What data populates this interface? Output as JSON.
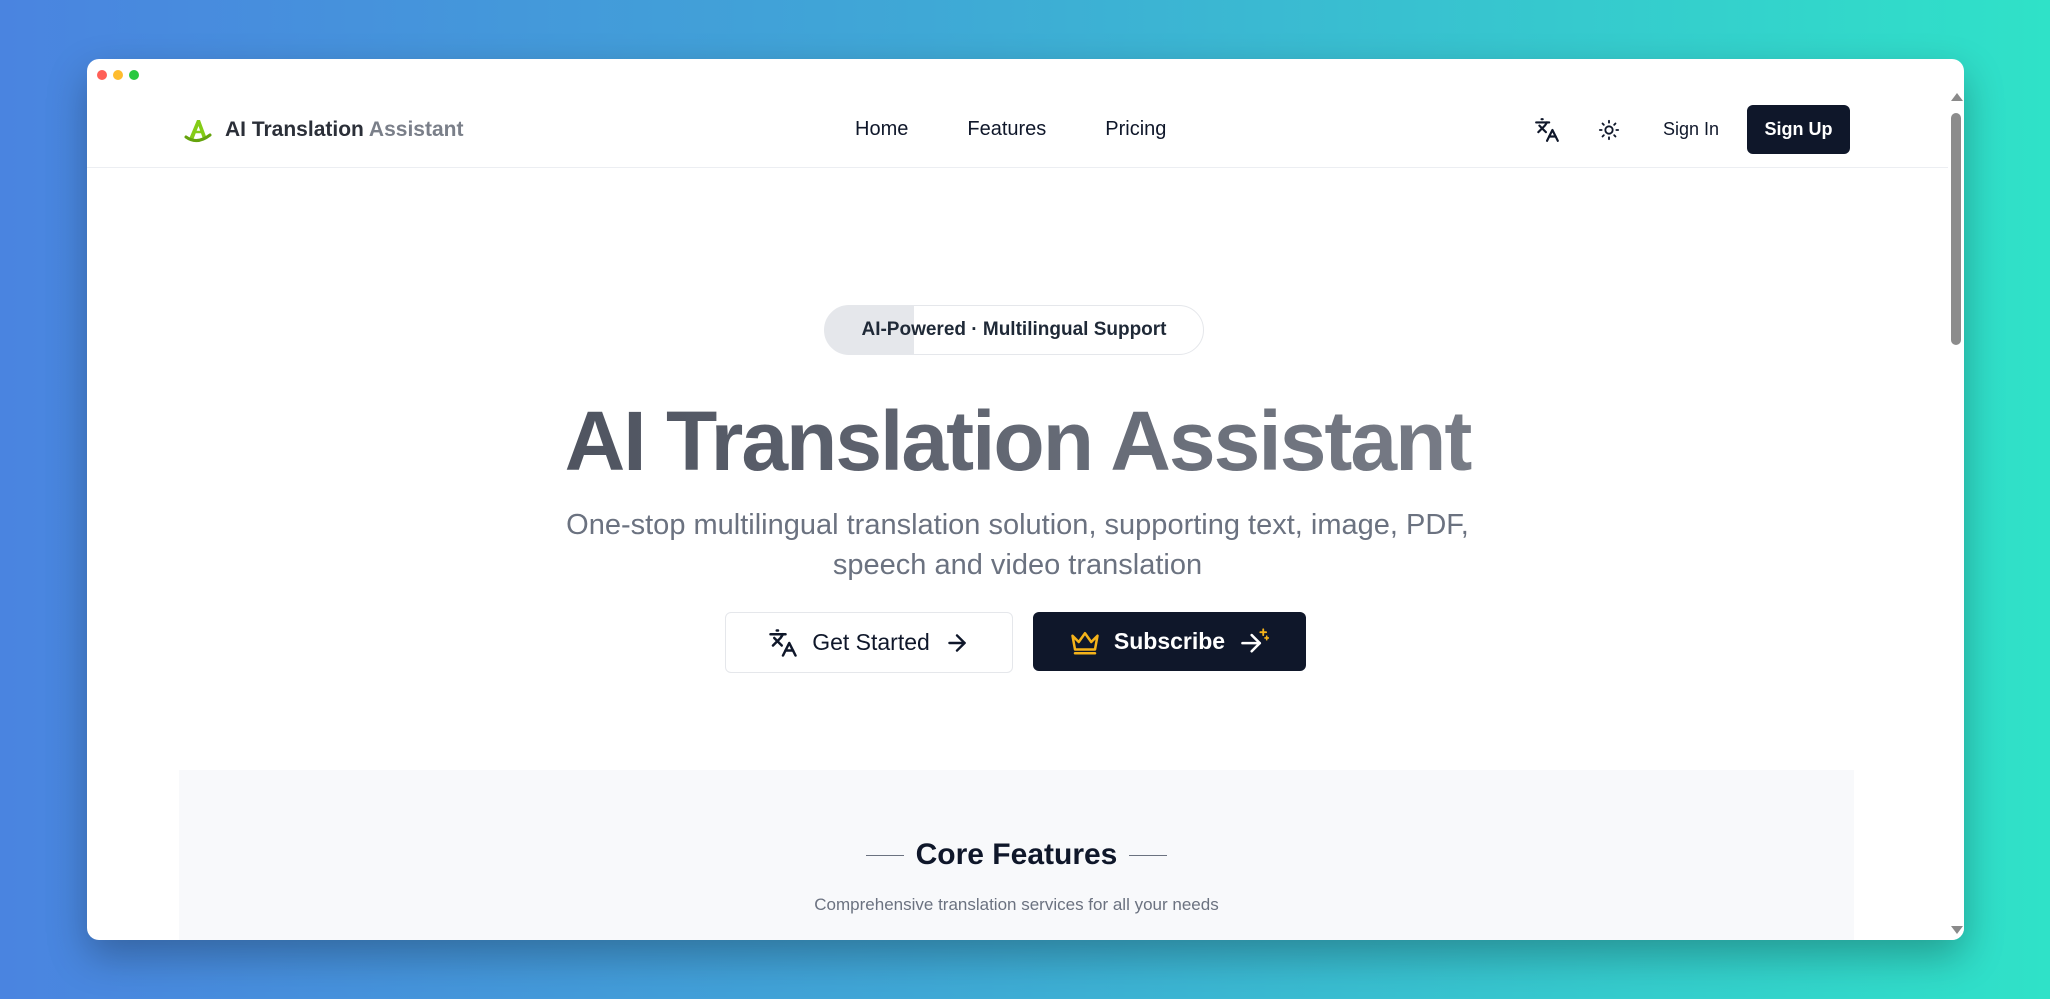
{
  "nav": {
    "brand_part1": "AI Translation",
    "brand_part2": "Assistant",
    "links": [
      "Home",
      "Features",
      "Pricing"
    ],
    "sign_in": "Sign In",
    "sign_up": "Sign Up",
    "icons": [
      "translate-icon",
      "sun-icon"
    ]
  },
  "hero": {
    "badge": "AI-Powered · Multilingual Support",
    "title": "AI Translation Assistant",
    "subtitle_line1": "One-stop multilingual translation solution, supporting text, image, PDF,",
    "subtitle_line2": "speech and video translation",
    "get_started": "Get Started",
    "subscribe": "Subscribe"
  },
  "features": {
    "title": "Core Features",
    "subtitle": "Comprehensive translation services for all your needs"
  },
  "colors": {
    "primary_dark": "#0f172a",
    "accent_gold": "#f5b31a",
    "logo_green": "#84cc16"
  }
}
